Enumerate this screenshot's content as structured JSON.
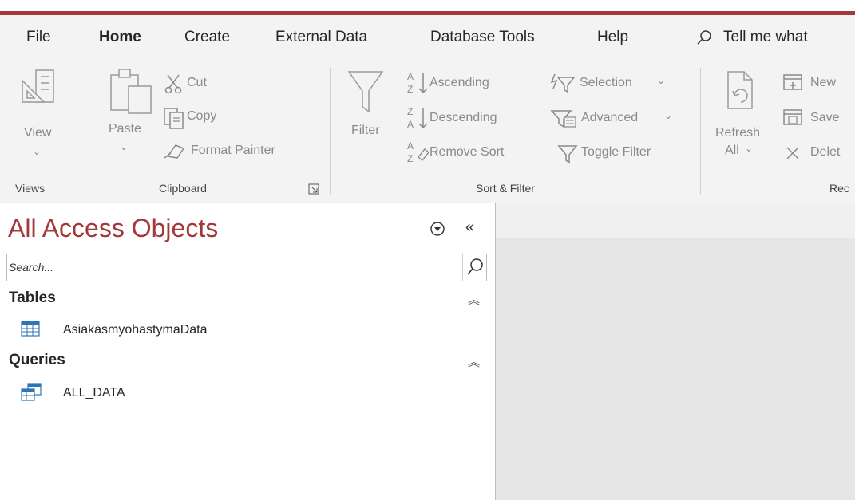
{
  "tabs": [
    "File",
    "Home",
    "Create",
    "External Data",
    "Database Tools",
    "Help"
  ],
  "tell_me": "Tell me what",
  "ribbon": {
    "views": {
      "view_label": "View",
      "group_label": "Views"
    },
    "clipboard": {
      "paste_label": "Paste",
      "cut_label": "Cut",
      "copy_label": "Copy",
      "format_painter_label": "Format Painter",
      "group_label": "Clipboard"
    },
    "sort_filter": {
      "filter_label": "Filter",
      "ascending_label": "Ascending",
      "descending_label": "Descending",
      "remove_sort_label": "Remove Sort",
      "selection_label": "Selection",
      "advanced_label": "Advanced",
      "toggle_filter_label": "Toggle Filter",
      "group_label": "Sort & Filter"
    },
    "records": {
      "refresh_label": "Refresh",
      "refresh_all_label": "All",
      "new_label": "New",
      "save_label": "Save",
      "delete_label": "Delet",
      "group_label": "Rec"
    }
  },
  "nav": {
    "title": "All Access Objects",
    "search_placeholder": "Search...",
    "sections": [
      {
        "label": "Tables",
        "items": [
          "AsiakasmyohastymaData"
        ]
      },
      {
        "label": "Queries",
        "items": [
          "ALL_DATA"
        ]
      }
    ]
  },
  "colors": {
    "accent": "#a4373a",
    "ribbon_bg": "#f3f3f3",
    "workspace_bg": "#e6e6e6"
  }
}
